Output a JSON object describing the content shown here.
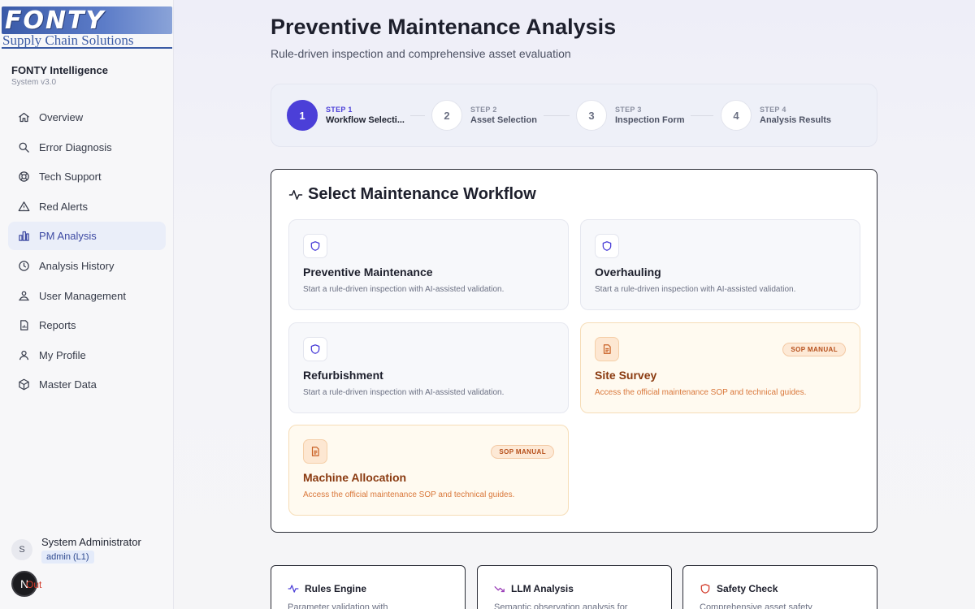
{
  "logo": {
    "brand": "FONTY",
    "tagline": "Supply Chain Solutions"
  },
  "app": {
    "name": "FONTY Intelligence",
    "version": "System v3.0"
  },
  "sidebar": {
    "items": [
      {
        "label": "Overview",
        "icon": "home-icon"
      },
      {
        "label": "Error Diagnosis",
        "icon": "search-icon"
      },
      {
        "label": "Tech Support",
        "icon": "support-icon"
      },
      {
        "label": "Red Alerts",
        "icon": "alert-triangle-icon"
      },
      {
        "label": "PM Analysis",
        "icon": "bar-chart-icon",
        "active": true
      },
      {
        "label": "Analysis History",
        "icon": "clock-icon"
      },
      {
        "label": "User Management",
        "icon": "users-icon"
      },
      {
        "label": "Reports",
        "icon": "report-icon"
      },
      {
        "label": "My Profile",
        "icon": "user-icon"
      },
      {
        "label": "Master Data",
        "icon": "box-icon"
      }
    ]
  },
  "user": {
    "initial": "S",
    "name": "System Administrator",
    "role": "admin (L1)"
  },
  "signout": {
    "badge": "N",
    "label": "Out"
  },
  "header": {
    "title": "Preventive Maintenance Analysis",
    "subtitle": "Rule-driven inspection and comprehensive asset evaluation"
  },
  "stepper": {
    "steps": [
      {
        "num": "1",
        "kicker": "STEP 1",
        "label": "Workflow Selecti...",
        "active": true
      },
      {
        "num": "2",
        "kicker": "STEP 2",
        "label": "Asset Selection"
      },
      {
        "num": "3",
        "kicker": "STEP 3",
        "label": "Inspection Form"
      },
      {
        "num": "4",
        "kicker": "STEP 4",
        "label": "Analysis Results"
      }
    ]
  },
  "workflow": {
    "title": "Select Maintenance Workflow",
    "options": [
      {
        "title": "Preventive Maintenance",
        "desc": "Start a rule-driven inspection with AI-assisted validation.",
        "icon": "shield-icon"
      },
      {
        "title": "Overhauling",
        "desc": "Start a rule-driven inspection with AI-assisted validation.",
        "icon": "shield-icon"
      },
      {
        "title": "Refurbishment",
        "desc": "Start a rule-driven inspection with AI-assisted validation.",
        "icon": "shield-icon"
      },
      {
        "title": "Site Survey",
        "desc": "Access the official maintenance SOP and technical guides.",
        "icon": "document-icon",
        "badge": "SOP MANUAL"
      },
      {
        "title": "Machine Allocation",
        "desc": "Access the official maintenance SOP and technical guides.",
        "icon": "document-icon",
        "badge": "SOP MANUAL"
      }
    ]
  },
  "features": [
    {
      "title": "Rules Engine",
      "desc": "Parameter validation with",
      "icon": "activity-icon"
    },
    {
      "title": "LLM Analysis",
      "desc": "Semantic observation analysis for",
      "icon": "trend-down-icon"
    },
    {
      "title": "Safety Check",
      "desc": "Comprehensive asset safety",
      "icon": "shield-icon"
    }
  ],
  "colors": {
    "accent": "#4b3fd8",
    "sop_accent": "#d9773a",
    "danger": "#d23b2b"
  }
}
